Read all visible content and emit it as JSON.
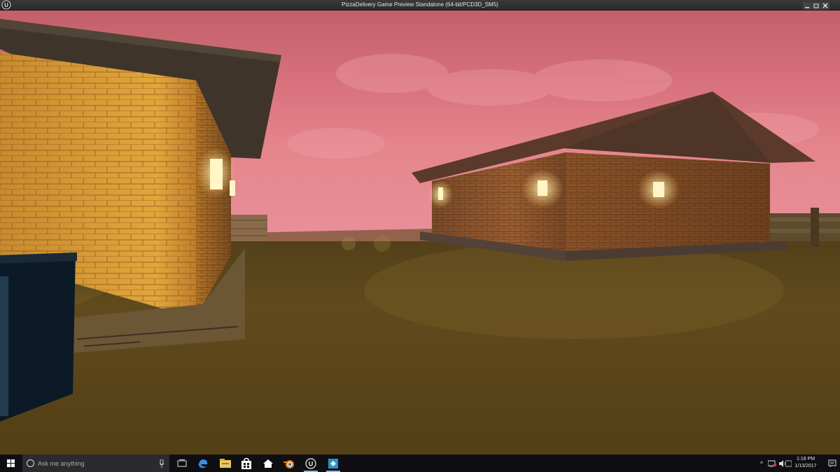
{
  "window": {
    "title": "PizzaDelivery Game Preview Standalone (64-bit/PCD3D_SM5)",
    "controls": [
      "minimize",
      "maximize",
      "close"
    ]
  },
  "scene": {
    "sky_color": "#d9747e",
    "ground_color": "#6b5322",
    "light_color": "#fff2b0"
  },
  "taskbar": {
    "search_placeholder": "Ask me anything",
    "apps": [
      "task-view-icon",
      "edge-icon",
      "file-explorer-icon",
      "store-icon",
      "home-icon",
      "blender-icon",
      "unreal-engine-icon",
      "app-icon"
    ],
    "tray_chevron": "^",
    "clock_time": "1:18 PM",
    "clock_date": "1/13/2017"
  }
}
